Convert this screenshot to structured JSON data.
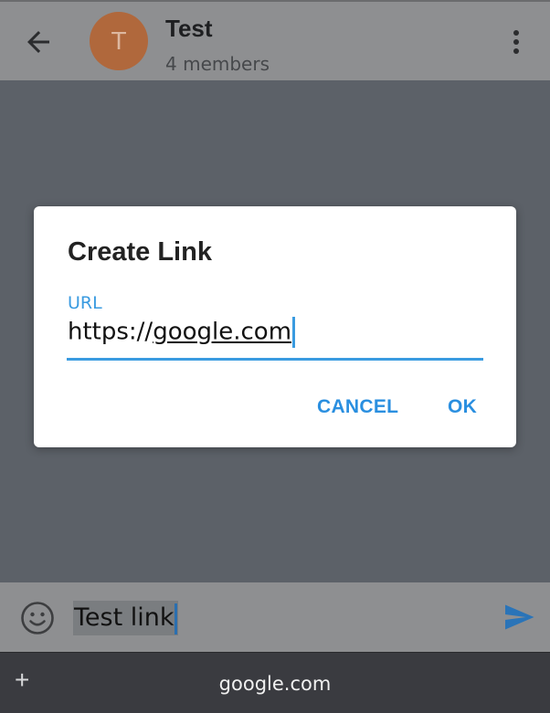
{
  "header": {
    "back_icon": "arrow-left-icon",
    "avatar_letter": "T",
    "avatar_color": "#b0683c",
    "title": "Test",
    "subtitle": "4 members",
    "menu_icon": "more-vert-icon"
  },
  "dialog": {
    "title": "Create Link",
    "url_label": "URL",
    "url_prefix": "https://",
    "url_domain": "google.com",
    "cancel_label": "CANCEL",
    "ok_label": "OK",
    "accent_color": "#3a9be0"
  },
  "composer": {
    "emoji_icon": "smiley-icon",
    "message_text": "Test link",
    "send_icon": "send-icon"
  },
  "keyboard_bar": {
    "plus_label": "+",
    "suggestion": "google.com"
  }
}
